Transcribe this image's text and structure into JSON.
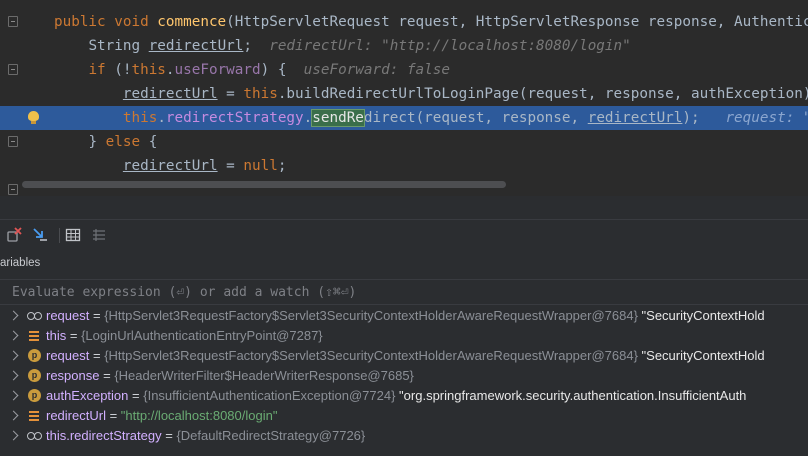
{
  "editor": {
    "lines": [
      {
        "indent": "",
        "parts": [
          {
            "t": "public void ",
            "c": "kw"
          },
          {
            "t": "commence",
            "c": "fn"
          },
          {
            "t": "(HttpServletRequest request, HttpServletResponse response, Authenticat",
            "c": ""
          }
        ]
      },
      {
        "indent": "    ",
        "parts": [
          {
            "t": "String ",
            "c": ""
          },
          {
            "t": "redirectUrl",
            "c": "ul"
          },
          {
            "t": ";  ",
            "c": ""
          },
          {
            "t": "redirectUrl: \"http://localhost:8080/login\"",
            "c": "hint"
          }
        ]
      },
      {
        "indent": "    ",
        "parts": [
          {
            "t": "if ",
            "c": "kw"
          },
          {
            "t": "(!",
            "c": ""
          },
          {
            "t": "this",
            "c": "kw"
          },
          {
            "t": ".",
            "c": ""
          },
          {
            "t": "useForward",
            "c": "fld"
          },
          {
            "t": ") {  ",
            "c": ""
          },
          {
            "t": "useForward: false",
            "c": "hint"
          }
        ]
      },
      {
        "indent": "        ",
        "parts": [
          {
            "t": "redirectUrl",
            "c": "ul"
          },
          {
            "t": " = ",
            "c": ""
          },
          {
            "t": "this",
            "c": "kw"
          },
          {
            "t": ".buildRedirectUrlToLoginPage(request, response, authException);",
            "c": ""
          }
        ]
      },
      {
        "indent": "        ",
        "highlighted": true,
        "parts": [
          {
            "t": "this",
            "c": "kw"
          },
          {
            "t": ".",
            "c": ""
          },
          {
            "t": "redirectStrategy",
            "c": "fld"
          },
          {
            "t": ".",
            "c": ""
          },
          {
            "t": "sendRe",
            "c": "sel-box"
          },
          {
            "t": "direct(request, response, ",
            "c": ""
          },
          {
            "t": "redirectUrl",
            "c": "ul"
          },
          {
            "t": ");   ",
            "c": ""
          },
          {
            "t": "request: \"Sec",
            "c": "hint"
          }
        ]
      },
      {
        "indent": "    ",
        "parts": [
          {
            "t": "} ",
            "c": ""
          },
          {
            "t": "else",
            "c": "kw"
          },
          {
            "t": " {",
            "c": ""
          }
        ]
      },
      {
        "indent": "        ",
        "parts": [
          {
            "t": "redirectUrl",
            "c": "ul"
          },
          {
            "t": " = ",
            "c": ""
          },
          {
            "t": "null",
            "c": "kw"
          },
          {
            "t": ";",
            "c": ""
          }
        ]
      }
    ]
  },
  "debugger": {
    "panel_title": "ariables",
    "eval_placeholder": "Evaluate expression (⏎) or add a watch (⇧⌘⏎)",
    "variables": [
      {
        "icon": "watch",
        "name": "request",
        "value": "{HttpServlet3RequestFactory$Servlet3SecurityContextHolderAwareRequestWrapper@7684}",
        "extra": " \"SecurityContextHold"
      },
      {
        "icon": "field",
        "name": "this",
        "value": "{LoginUrlAuthenticationEntryPoint@7287}",
        "extra": ""
      },
      {
        "icon": "param",
        "name": "request",
        "value": "{HttpServlet3RequestFactory$Servlet3SecurityContextHolderAwareRequestWrapper@7684}",
        "extra": " \"SecurityContextHold"
      },
      {
        "icon": "param",
        "name": "response",
        "value": "{HeaderWriterFilter$HeaderWriterResponse@7685}",
        "extra": ""
      },
      {
        "icon": "param",
        "name": "authException",
        "value": "{InsufficientAuthenticationException@7724}",
        "extra": " \"org.springframework.security.authentication.InsufficientAuth"
      },
      {
        "icon": "field",
        "name": "redirectUrl",
        "value": "\"http://localhost:8080/login\"",
        "extra": "",
        "string": true
      },
      {
        "icon": "watch",
        "name": "this.redirectStrategy",
        "value": "{DefaultRedirectStrategy@7726}",
        "extra": ""
      }
    ]
  },
  "colors": {
    "editor_bg": "#2b2b2b",
    "current_line": "#2d5a9b",
    "keyword": "#cc7832",
    "field": "#9876aa",
    "var_name": "#d2b0ff",
    "string": "#6aab73"
  },
  "icons": [
    "fold-icon",
    "lightbulb-icon",
    "clear-breakpoints-icon",
    "step-into-icon",
    "table-view-icon",
    "list-view-icon",
    "expand-chevron-icon",
    "watch-icon",
    "field-icon",
    "parameter-icon"
  ]
}
